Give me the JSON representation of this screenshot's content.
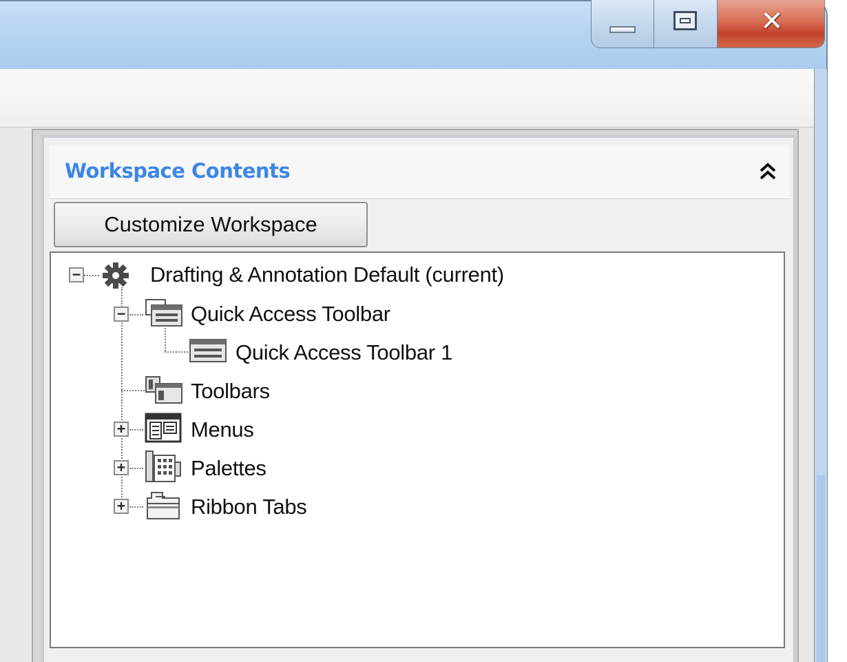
{
  "window": {
    "caption_buttons": {
      "minimize": "minimize-icon",
      "maximize": "maximize-icon",
      "close": "close-icon"
    }
  },
  "panel": {
    "title": "Workspace Contents",
    "collapse_icon": "chevron-double-up-icon",
    "customize_button_label": "Customize Workspace"
  },
  "tree": {
    "nodes": [
      {
        "label": "Drafting & Annotation Default (current)",
        "icon": "gear-icon",
        "expander": "−",
        "level": 0
      },
      {
        "label": "Quick Access Toolbar",
        "icon": "toolbar-group-icon",
        "expander": "−",
        "level": 1
      },
      {
        "label": "Quick Access Toolbar 1",
        "icon": "toolbar-icon",
        "expander": "",
        "level": 2
      },
      {
        "label": "Toolbars",
        "icon": "toolbars-icon",
        "expander": "",
        "level": 1
      },
      {
        "label": "Menus",
        "icon": "menus-icon",
        "expander": "+",
        "level": 1
      },
      {
        "label": "Palettes",
        "icon": "palettes-icon",
        "expander": "+",
        "level": 1
      },
      {
        "label": "Ribbon Tabs",
        "icon": "ribbon-tabs-icon",
        "expander": "+",
        "level": 1
      }
    ]
  },
  "colors": {
    "title_accent": "#3d86e6",
    "titlebar": "#b7d4f1",
    "close_button": "#c2412a"
  }
}
